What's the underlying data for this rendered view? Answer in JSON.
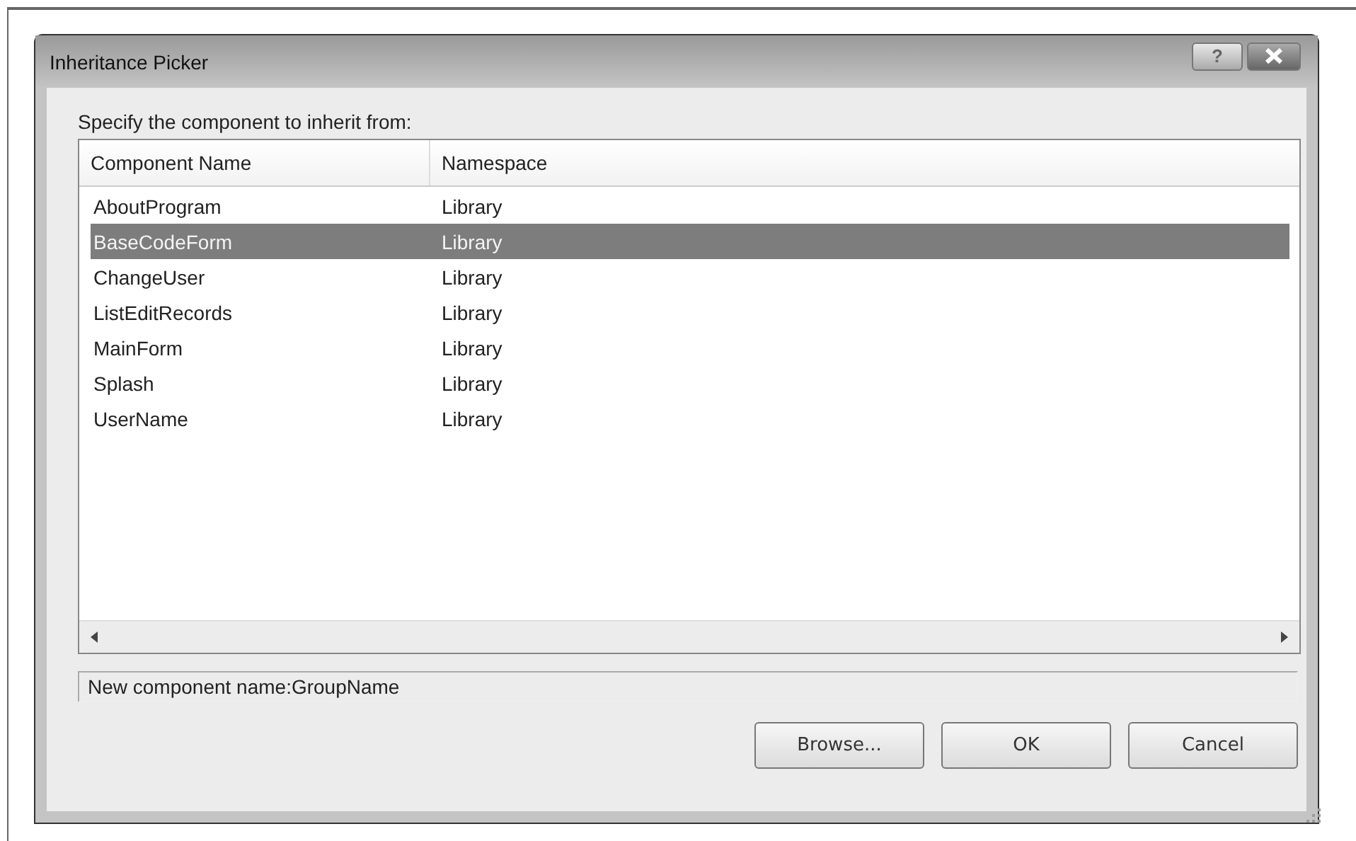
{
  "window": {
    "title": "Inheritance Picker"
  },
  "title_buttons": [
    {
      "kind": "help",
      "label": "?"
    },
    {
      "kind": "close"
    }
  ],
  "prompt": "Specify the component to inherit from:",
  "table": {
    "columns": [
      "Component Name",
      "Namespace"
    ],
    "rows": [
      {
        "cells": [
          "AboutProgram",
          "Library"
        ],
        "selected": false
      },
      {
        "cells": [
          "BaseCodeForm",
          "Library"
        ],
        "selected": true
      },
      {
        "cells": [
          "ChangeUser",
          "Library"
        ],
        "selected": false
      },
      {
        "cells": [
          "ListEditRecords",
          "Library"
        ],
        "selected": false
      },
      {
        "cells": [
          "MainForm",
          "Library"
        ],
        "selected": false
      },
      {
        "cells": [
          "Splash",
          "Library"
        ],
        "selected": false
      },
      {
        "cells": [
          "UserName",
          "Library"
        ],
        "selected": false
      }
    ]
  },
  "status": "New component name:GroupName",
  "buttons": [
    "Browse...",
    "OK",
    "Cancel"
  ]
}
